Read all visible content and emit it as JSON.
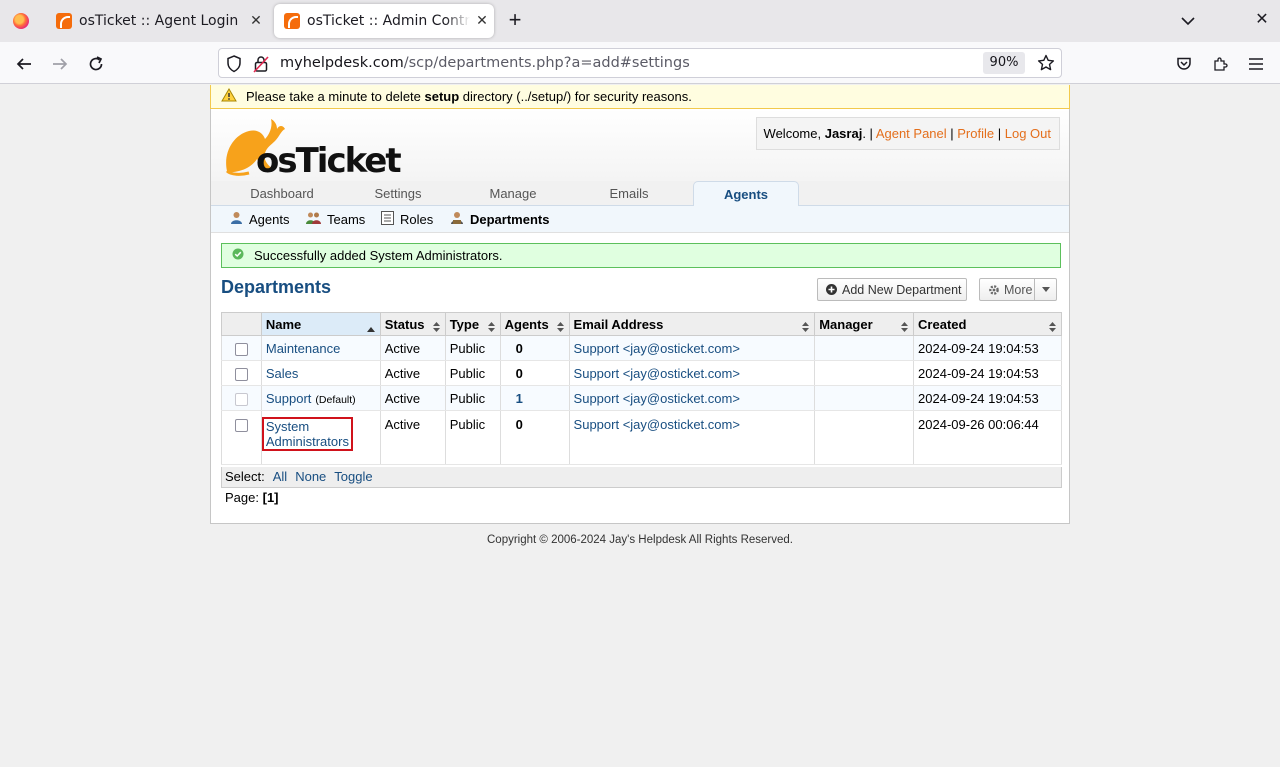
{
  "browser": {
    "tabs": [
      {
        "title": "osTicket :: Agent Login"
      },
      {
        "title": "osTicket :: Admin Control Panel"
      }
    ],
    "url_host": "myhelpdesk.com",
    "url_path": "/scp/departments.php?a=add#settings",
    "zoom": "90%"
  },
  "warning": {
    "pre": "Please take a minute to delete ",
    "bold": "setup",
    "post": " directory (../setup/) for security reasons."
  },
  "logo_text": "osTicket",
  "user": {
    "welcome": "Welcome, ",
    "name": "Jasraj",
    "after_name": ". | ",
    "agent_panel": "Agent Panel",
    "sep": " | ",
    "profile": "Profile",
    "logout": "Log Out"
  },
  "nav": {
    "tabs": [
      "Dashboard",
      "Settings",
      "Manage",
      "Emails",
      "Agents"
    ],
    "sub": [
      "Agents",
      "Teams",
      "Roles",
      "Departments"
    ]
  },
  "success_message": "Successfully added System Administrators.",
  "page_title": "Departments",
  "buttons": {
    "add": "Add New Department",
    "more": "More"
  },
  "table": {
    "headers": [
      "Name",
      "Status",
      "Type",
      "Agents",
      "Email Address",
      "Manager",
      "Created"
    ],
    "rows": [
      {
        "name": "Maintenance",
        "note": "",
        "status": "Active",
        "type": "Public",
        "agents": "0",
        "email": "Support <jay@osticket.com>",
        "manager": "",
        "created": "2024-09-24 19:04:53"
      },
      {
        "name": "Sales",
        "note": "",
        "status": "Active",
        "type": "Public",
        "agents": "0",
        "email": "Support <jay@osticket.com>",
        "manager": "",
        "created": "2024-09-24 19:04:53"
      },
      {
        "name": "Support",
        "note": "(Default)",
        "status": "Active",
        "type": "Public",
        "agents": "1",
        "email": "Support <jay@osticket.com>",
        "manager": "",
        "created": "2024-09-24 19:04:53"
      },
      {
        "name": "System Administrators",
        "note": "",
        "status": "Active",
        "type": "Public",
        "agents": "0",
        "email": "Support <jay@osticket.com>",
        "manager": "",
        "created": "2024-09-26 00:06:44"
      }
    ]
  },
  "select": {
    "label": "Select:",
    "all": "All",
    "none": "None",
    "toggle": "Toggle"
  },
  "pager": {
    "label": "Page:",
    "current": "[1]"
  },
  "footer": "Copyright © 2006-2024 Jay's Helpdesk All Rights Reserved.",
  "icons": {
    "warning": "warning-icon",
    "success": "check-circle-icon",
    "add": "plus-circle-icon",
    "more": "gear-icon"
  },
  "colors": {
    "link": "#184e81",
    "accent": "#e46f1c",
    "highlight_border": "#d0121b",
    "success_bg": "#e0ffe0",
    "warning_bg": "#fffde0"
  }
}
